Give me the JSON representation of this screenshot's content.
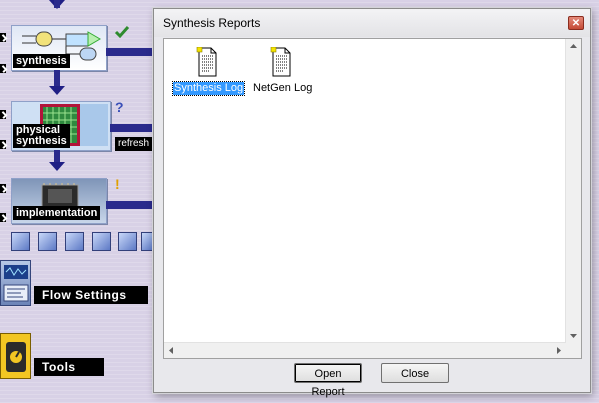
{
  "flow": {
    "steps": [
      {
        "label": "synthesis"
      },
      {
        "label": "physical\nsynthesis"
      },
      {
        "label": "implementation"
      }
    ],
    "status_question": "?",
    "status_warning": "!",
    "refresh_label": "refresh",
    "flow_settings_label": "Flow Settings",
    "tools_label": "Tools",
    "colors": {
      "flow_line": "#2a2a8c",
      "check": "#2e8b2e",
      "warn": "#e0a000",
      "question": "#3a4fb8"
    }
  },
  "dialog": {
    "title": "Synthesis Reports",
    "files": [
      {
        "label": "Synthesis Log",
        "selected": true
      },
      {
        "label": "NetGen Log",
        "selected": false
      }
    ],
    "open_report_label": "Open Report",
    "close_label": "Close"
  }
}
